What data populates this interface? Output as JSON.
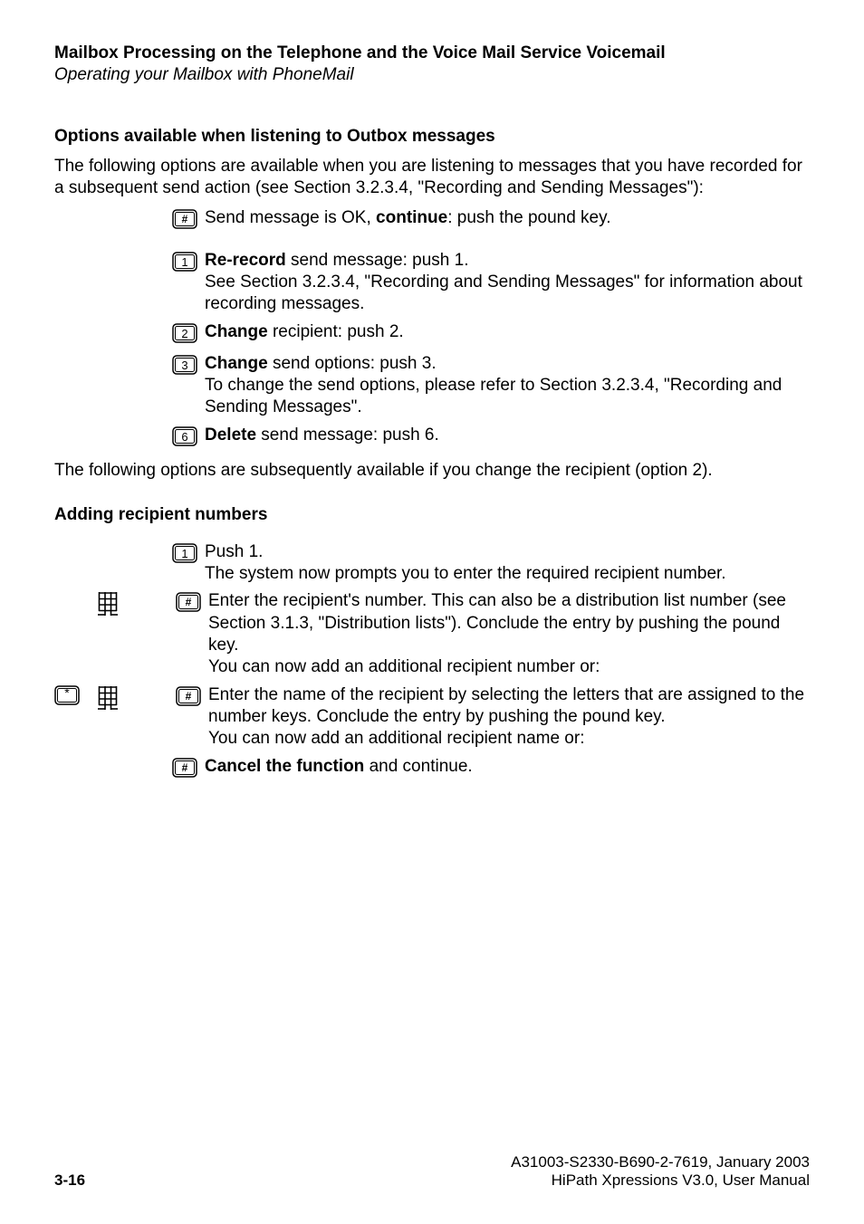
{
  "header": {
    "title": "Mailbox Processing on the Telephone and the Voice Mail Service Voicemail",
    "subtitle": "Operating your Mailbox with PhoneMail"
  },
  "section1": {
    "heading": "Options available when listening to Outbox messages",
    "intro": "The following options are available when you are listening to messages that you have recorded for a subsequent send action (see Section 3.2.3.4, \"Recording and Sending Messages\"):",
    "items": [
      {
        "key": "#",
        "pre": "Send message is OK, ",
        "bold": "continue",
        "post": ": push the pound key."
      },
      {
        "key": "1",
        "bold": "Re-record",
        "post": " send message: push 1.",
        "extra": "See Section 3.2.3.4, \"Recording and Sending Messages\" for information about recording messages."
      },
      {
        "key": "2",
        "bold": "Change",
        "post": " recipient: push 2."
      },
      {
        "key": "3",
        "bold": "Change",
        "post": " send options: push 3.",
        "extra": "To change the send options, please refer to Section 3.2.3.4, \"Recording and Sending Messages\"."
      },
      {
        "key": "6",
        "bold": "Delete",
        "post": " send message: push 6."
      }
    ],
    "followup": "The following options are subsequently available if you change the recipient (option 2)."
  },
  "section2": {
    "heading": "Adding recipient numbers",
    "items": [
      {
        "key": "1",
        "line1": "Push 1.",
        "line2": "The system now prompts you to enter the required recipient number."
      },
      {
        "prefix1": "keypad",
        "key": "#",
        "text": "Enter the recipient's number. This can also be a distribution list number (see Section 3.1.3, \"Distribution lists\"). Conclude the entry by pushing the pound key.",
        "text2": "You can now add an additional recipient number or:"
      },
      {
        "prefix1": "star",
        "prefix2": "keypad",
        "key": "#",
        "text": "Enter the name of the recipient by selecting the letters that are assigned to the number keys. Conclude the entry by pushing the pound key.",
        "text2": "You can now add an additional recipient name or:"
      },
      {
        "key": "#",
        "bold": "Cancel the function",
        "post": " and continue."
      }
    ]
  },
  "footer": {
    "page": "3-16",
    "docid": "A31003-S2330-B690-2-7619, January 2003",
    "product": "HiPath Xpressions V3.0, User Manual"
  }
}
